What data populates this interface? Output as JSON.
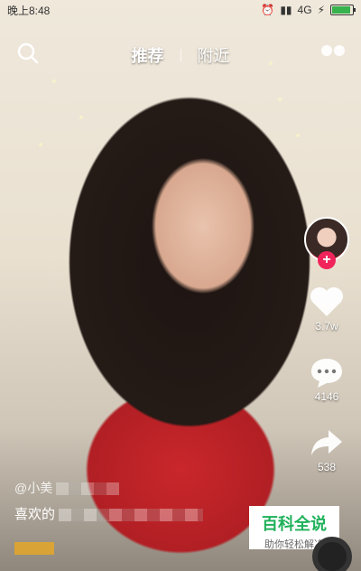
{
  "status_bar": {
    "time": "晚上8:48",
    "network": "4G"
  },
  "top_nav": {
    "tabs": [
      {
        "label": "推荐"
      },
      {
        "label": "附近"
      }
    ]
  },
  "actions": {
    "likes": "3.7w",
    "comments": "4146",
    "shares": "538"
  },
  "video": {
    "username": "@小美",
    "description_prefix": "喜欢的"
  },
  "watermark": {
    "title": "百科全说",
    "subtitle": "助你轻松解决"
  },
  "colors": {
    "accent": "#f0245a",
    "watermark_green": "#20b15a"
  }
}
